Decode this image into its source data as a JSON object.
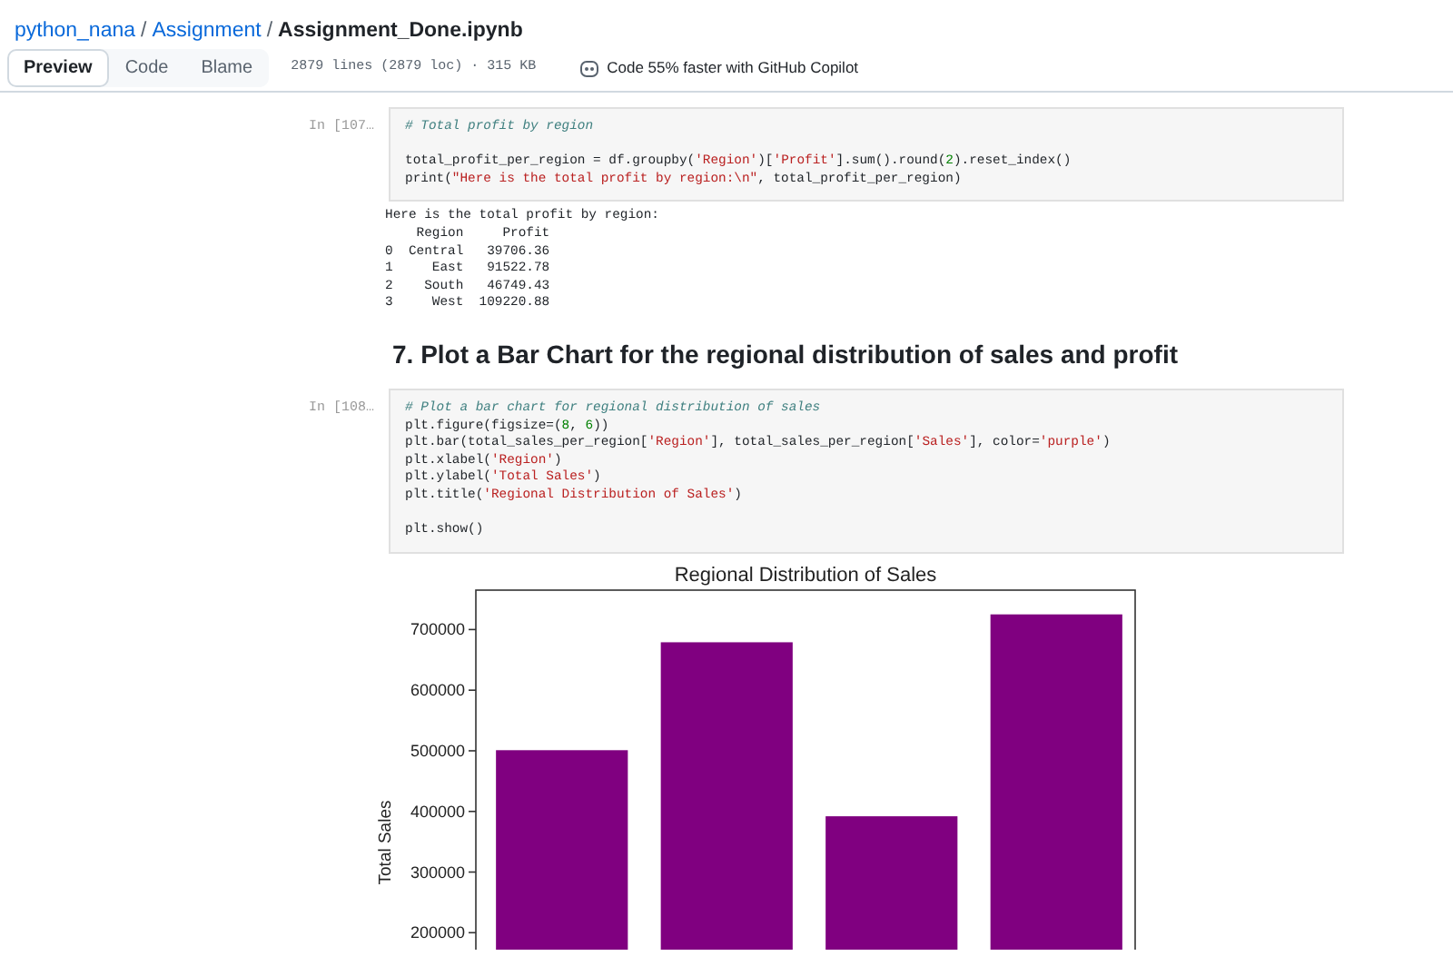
{
  "breadcrumb": [
    {
      "label": "python_nana",
      "kind": "link"
    },
    {
      "label": "/",
      "kind": "separator"
    },
    {
      "label": "Assignment",
      "kind": "link"
    },
    {
      "label": "/",
      "kind": "separator"
    },
    {
      "label": "Assignment_Done.ipynb",
      "kind": "current"
    }
  ],
  "view_tabs": [
    {
      "label": "Preview",
      "selected": true
    },
    {
      "label": "Code",
      "selected": false
    },
    {
      "label": "Blame",
      "selected": false
    }
  ],
  "file_info": "2879 lines (2879 loc) · 315 KB",
  "copilot_note": "Code 55% faster with GitHub Copilot",
  "cells": [
    {
      "kind": "code",
      "prompt": "In [107…",
      "lines": [
        {
          "segments": [
            {
              "t": "# Total profit by region",
              "color": "#408080",
              "italic": true
            }
          ]
        },
        {
          "gap_before": true,
          "segments": [
            {
              "t": "total_profit_per_region = df.groupby("
            },
            {
              "t": "'Region'",
              "color": "#ba2121"
            },
            {
              "t": ")["
            },
            {
              "t": "'Profit'",
              "color": "#ba2121"
            },
            {
              "t": "].sum().round("
            },
            {
              "t": "2",
              "color": "#008000"
            },
            {
              "t": ").reset_index()"
            }
          ]
        },
        {
          "segments": [
            {
              "t": "print("
            },
            {
              "t": "\"Here is the total profit by region:\\n\"",
              "color": "#ba2121"
            },
            {
              "t": ", total_profit_per_region)"
            }
          ]
        }
      ],
      "output": [
        "Here is the total profit by region:",
        "    Region     Profit",
        "0  Central   39706.36",
        "1     East   91522.78",
        "2    South   46749.43",
        "3     West  109220.88"
      ]
    },
    {
      "kind": "heading",
      "text": "7. Plot a Bar Chart for the regional distribution of sales and profit"
    },
    {
      "kind": "code",
      "prompt": "In [108…",
      "lines": [
        {
          "segments": [
            {
              "t": "# Plot a bar chart for regional distribution of sales",
              "color": "#408080",
              "italic": true
            }
          ]
        },
        {
          "segments": [
            {
              "t": "plt.figure(figsize=("
            },
            {
              "t": "8",
              "color": "#008000"
            },
            {
              "t": ", "
            },
            {
              "t": "6",
              "color": "#008000"
            },
            {
              "t": "))"
            }
          ]
        },
        {
          "segments": [
            {
              "t": "plt.bar(total_sales_per_region["
            },
            {
              "t": "'Region'",
              "color": "#ba2121"
            },
            {
              "t": "], total_sales_per_region["
            },
            {
              "t": "'Sales'",
              "color": "#ba2121"
            },
            {
              "t": "], color="
            },
            {
              "t": "'purple'",
              "color": "#ba2121"
            },
            {
              "t": ")"
            }
          ]
        },
        {
          "segments": [
            {
              "t": "plt.xlabel("
            },
            {
              "t": "'Region'",
              "color": "#ba2121"
            },
            {
              "t": ")"
            }
          ]
        },
        {
          "segments": [
            {
              "t": "plt.ylabel("
            },
            {
              "t": "'Total Sales'",
              "color": "#ba2121"
            },
            {
              "t": ")"
            }
          ]
        },
        {
          "segments": [
            {
              "t": "plt.title("
            },
            {
              "t": "'Regional Distribution of Sales'",
              "color": "#ba2121"
            },
            {
              "t": ")"
            }
          ]
        },
        {
          "gap_before": true,
          "segments": [
            {
              "t": "plt.show()"
            }
          ]
        }
      ],
      "chart_data": {
        "type": "bar",
        "title": "Regional Distribution of Sales",
        "ylabel": "Total Sales",
        "ylim": [
          172000,
          765000
        ],
        "yticks": [
          200000,
          300000,
          400000,
          500000,
          600000,
          700000
        ],
        "series": [
          {
            "color": "#800080",
            "values": [
              501000,
              679000,
              392000,
              725000
            ]
          }
        ]
      }
    }
  ]
}
